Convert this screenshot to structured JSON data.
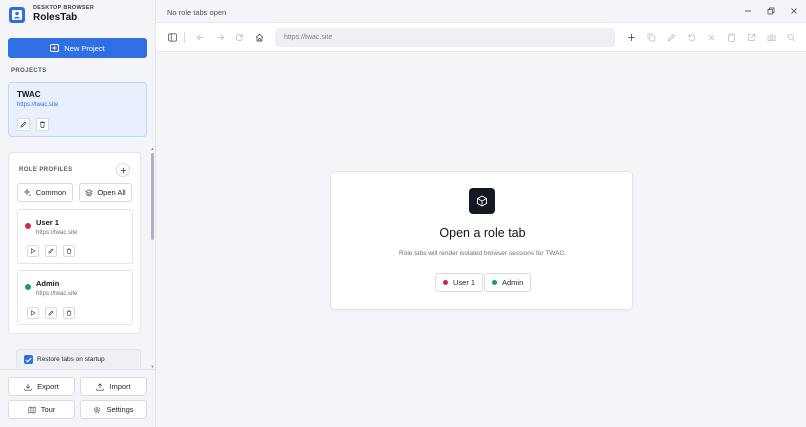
{
  "brand": {
    "subtitle": "DESKTOP BROWSER",
    "title": "RolesTab"
  },
  "sidebar": {
    "new_project_label": "New Project",
    "projects_heading": "PROJECTS",
    "project": {
      "name": "TWAC",
      "url": "https://twac.site"
    },
    "roles_heading": "ROLE PROFILES",
    "common_label": "Common",
    "open_all_label": "Open All",
    "roles": [
      {
        "name": "User 1",
        "url": "https://twac.site",
        "color": "#d4283f"
      },
      {
        "name": "Admin",
        "url": "https://twac.site",
        "color": "#1e9a5b"
      }
    ],
    "restore_label": "Restore tabs on startup",
    "restore_checked": true,
    "footer": {
      "export": "Export",
      "import": "Import",
      "tour": "Tour",
      "settings": "Settings"
    }
  },
  "titlebar": {
    "text": "No role tabs open"
  },
  "toolbar": {
    "url_placeholder": "https://twac.site"
  },
  "empty_state": {
    "title": "Open a role tab",
    "subtitle": "Role tabs will render isolated browser sessions for TWAC.",
    "chips": [
      {
        "label": "User 1",
        "color": "#d4283f"
      },
      {
        "label": "Admin",
        "color": "#1e9a5b"
      }
    ]
  },
  "colors": {
    "accent": "#2f6fe4",
    "user1": "#d4283f",
    "admin": "#1e9a5b"
  }
}
